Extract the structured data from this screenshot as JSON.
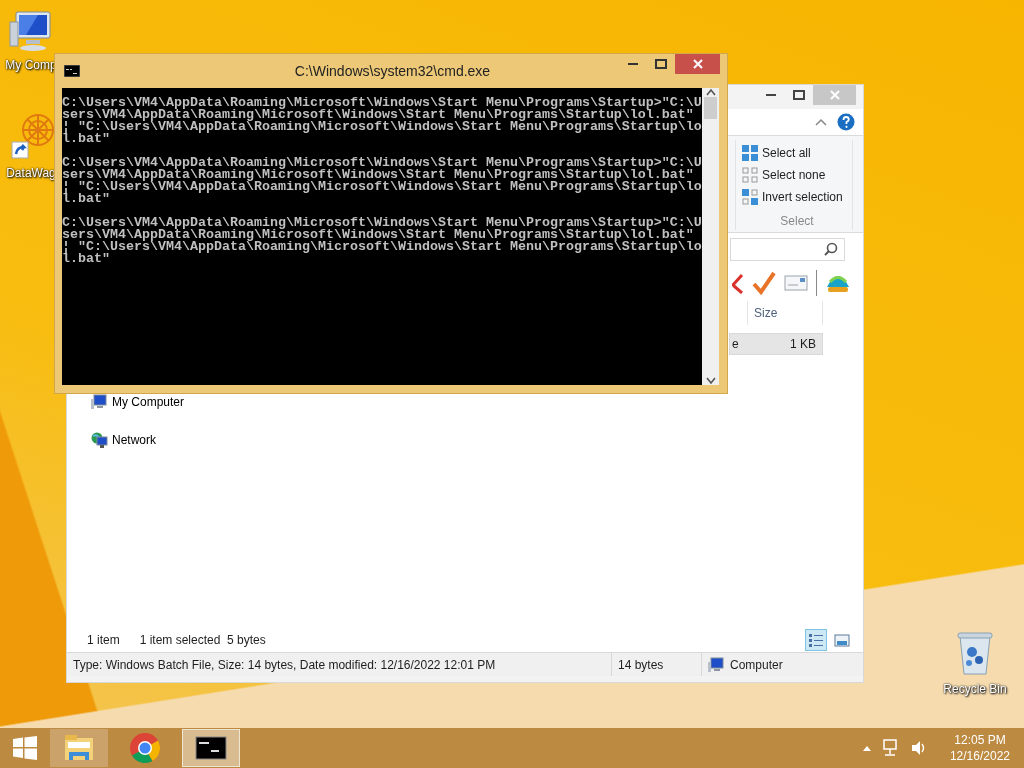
{
  "desktop_icons": [
    {
      "kind": "computer",
      "label": "My Comp"
    },
    {
      "kind": "shortcut",
      "label": "DataWag"
    },
    {
      "kind": "recycle",
      "label": "Recycle Bin"
    }
  ],
  "explorer": {
    "ribbon": {
      "commands": [
        {
          "kind": "all",
          "label": "Select all"
        },
        {
          "kind": "none",
          "label": "Select none"
        },
        {
          "kind": "invert",
          "label": "Invert selection"
        }
      ],
      "group_label": "Select"
    },
    "columns": [
      "Size"
    ],
    "rows": [
      {
        "column_1": "e",
        "size": "1 KB",
        "selected": true
      }
    ],
    "nav_items": [
      {
        "kind": "computer",
        "label": "My Computer"
      },
      {
        "kind": "network",
        "label": "Network"
      }
    ],
    "status": {
      "count": "1 item",
      "selection": "1 item selected  5 bytes"
    },
    "view_buttons": [
      {
        "kind": "details",
        "selected": true
      },
      {
        "kind": "large_icons",
        "selected": false
      }
    ],
    "details_bar": {
      "description": "Type: Windows Batch File, Size: 14 bytes, Date modified: 12/16/2022 12:01 PM",
      "size": "14 bytes",
      "location": "Computer"
    }
  },
  "cmd_window": {
    "title": "C:\\Windows\\system32\\cmd.exe",
    "blocks": [
      {
        "lines": [
          "C:\\Users\\VM4\\AppData\\Roaming\\Microsoft\\Windows\\Start Menu\\Programs\\Startup>\"C:\\U",
          "sers\\VM4\\AppData\\Roaming\\Microsoft\\Windows\\Start Menu\\Programs\\Startup\\lol.bat\"",
          "¦ \"C:\\Users\\VM4\\AppData\\Roaming\\Microsoft\\Windows\\Start Menu\\Programs\\Startup\\lo",
          "l.bat\""
        ]
      },
      {
        "lines": [
          "C:\\Users\\VM4\\AppData\\Roaming\\Microsoft\\Windows\\Start Menu\\Programs\\Startup>\"C:\\U",
          "sers\\VM4\\AppData\\Roaming\\Microsoft\\Windows\\Start Menu\\Programs\\Startup\\lol.bat\"",
          "¦ \"C:\\Users\\VM4\\AppData\\Roaming\\Microsoft\\Windows\\Start Menu\\Programs\\Startup\\lo",
          "l.bat\""
        ]
      },
      {
        "lines": [
          "C:\\Users\\VM4\\AppData\\Roaming\\Microsoft\\Windows\\Start Menu\\Programs\\Startup>\"C:\\U",
          "sers\\VM4\\AppData\\Roaming\\Microsoft\\Windows\\Start Menu\\Programs\\Startup\\lol.bat\"",
          "¦ \"C:\\Users\\VM4\\AppData\\Roaming\\Microsoft\\Windows\\Start Menu\\Programs\\Startup\\lo",
          "l.bat\""
        ]
      }
    ]
  },
  "taskbar": {
    "apps": [
      {
        "kind": "explorer",
        "running": true,
        "selected": false
      },
      {
        "kind": "chrome",
        "running": false,
        "selected": false
      },
      {
        "kind": "cmd",
        "running": true,
        "selected": true
      }
    ],
    "time": "12:05 PM",
    "date": "12/16/2022"
  }
}
